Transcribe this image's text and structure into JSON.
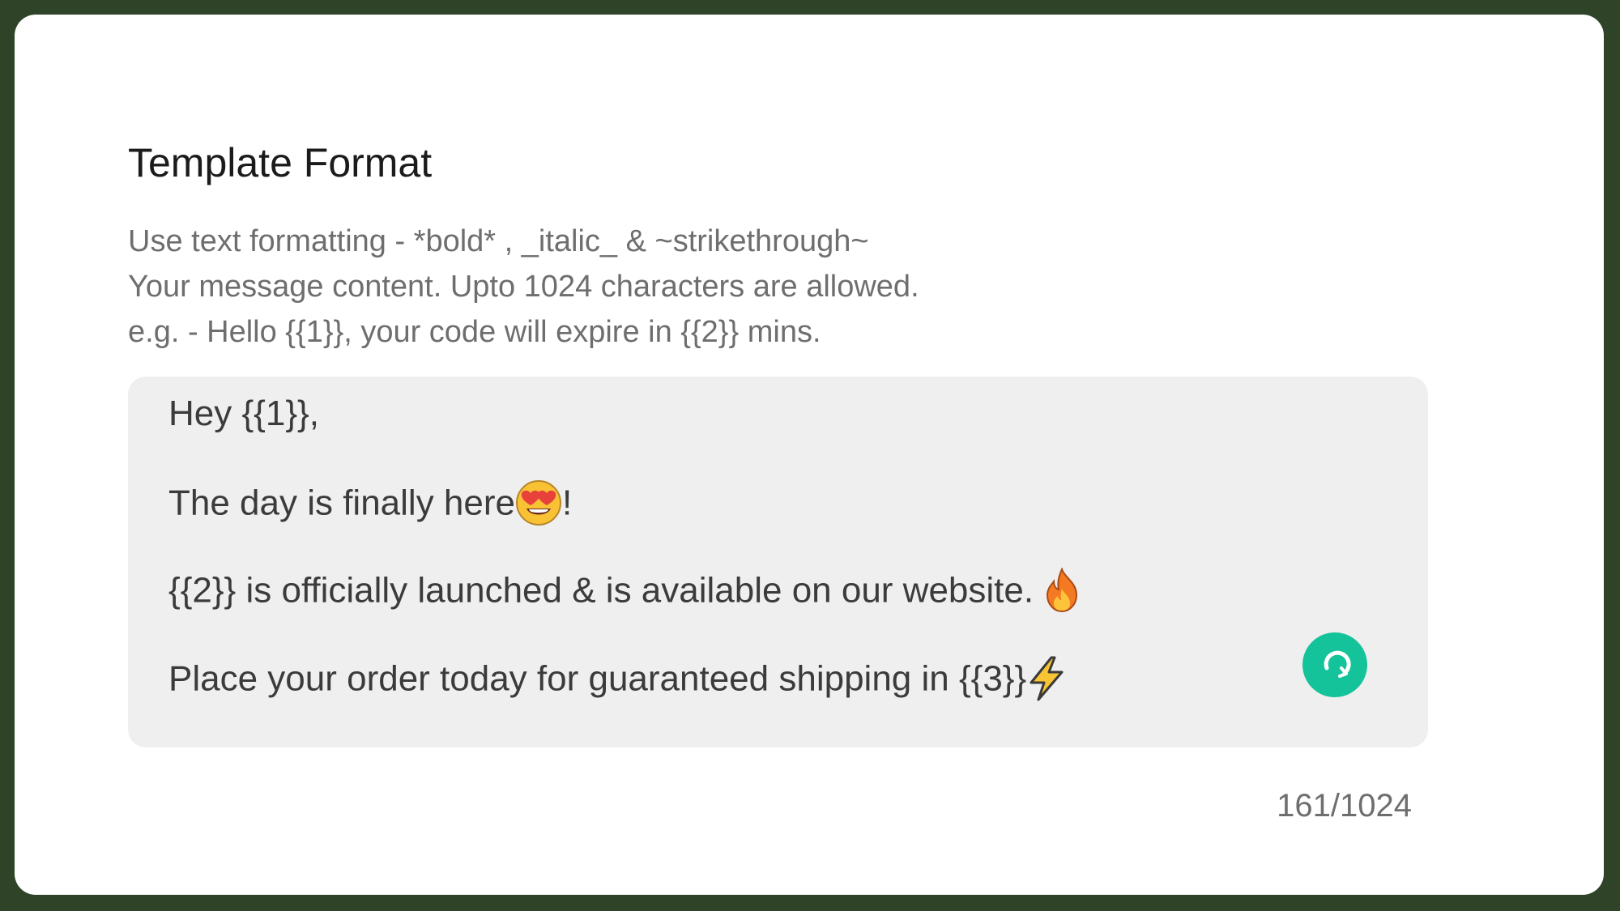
{
  "header": {
    "title": "Template Format"
  },
  "help": {
    "formatting": "Use text formatting - *bold* , _italic_ & ~strikethrough~",
    "limit": "Your message content. Upto 1024 characters are allowed.",
    "example": "e.g. - Hello {{1}}, your code will expire in {{2}} mins."
  },
  "editor": {
    "lines": [
      {
        "text": "Hey {{1}},",
        "emoji": "",
        "after": ""
      },
      {
        "text": "The day is finally here",
        "emoji": "heart-eyes-emoji",
        "after": "!"
      },
      {
        "text": "{{2}} is officially launched & is available on our website. ",
        "emoji": "fire-emoji",
        "after": ""
      },
      {
        "text": "Place your order today for guaranteed shipping in {{3}}",
        "emoji": "lightning-emoji",
        "after": ""
      }
    ],
    "grammar_button_color": "#15c39a",
    "background_color": "#efefef"
  },
  "counter": {
    "text": "161/1024"
  }
}
